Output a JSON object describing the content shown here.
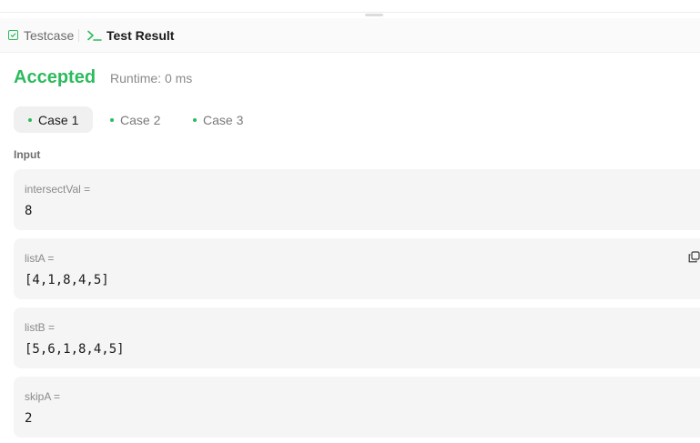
{
  "tabs": {
    "testcase_label": "Testcase",
    "result_label": "Test Result"
  },
  "result": {
    "status": "Accepted",
    "runtime": "Runtime: 0 ms"
  },
  "cases": [
    {
      "label": "Case 1"
    },
    {
      "label": "Case 2"
    },
    {
      "label": "Case 3"
    }
  ],
  "input": {
    "section_label": "Input",
    "params": [
      {
        "name": "intersectVal =",
        "value": "8"
      },
      {
        "name": "listA =",
        "value": "[4,1,8,4,5]"
      },
      {
        "name": "listB =",
        "value": "[5,6,1,8,4,5]"
      },
      {
        "name": "skipA =",
        "value": "2"
      }
    ]
  },
  "colors": {
    "accent_green": "#2cbb5d",
    "card_bg": "#f5f5f5"
  },
  "icons": {
    "testcase": "check-square-icon",
    "result": "terminal-icon",
    "copy": "copy-icon"
  }
}
